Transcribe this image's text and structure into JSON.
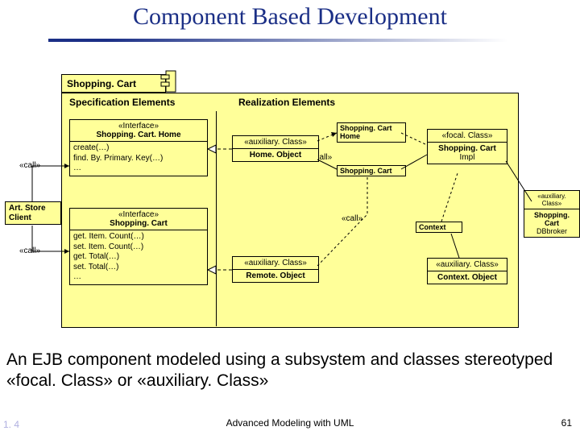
{
  "title": "Component Based Development",
  "tab": "Shopping. Cart",
  "sections": {
    "spec": "Specification Elements",
    "real": "Realization Elements"
  },
  "artstore": {
    "line1": "Art. Store",
    "line2": "Client"
  },
  "call": "«call»",
  "iface1": {
    "stereo": "«Interface»",
    "name": "Shopping. Cart. Home",
    "op1": "create(…)",
    "op2": "find. By. Primary. Key(…)",
    "op3": "…"
  },
  "iface2": {
    "stereo": "«Interface»",
    "name": "Shopping. Cart",
    "op1": "get. Item. Count(…)",
    "op2": "set. Item. Count(…)",
    "op3": "get. Total(…)",
    "op4": "set. Total(…)",
    "op5": "…"
  },
  "aux": "«auxiliary. Class»",
  "focal": "«focal. Class»",
  "homeObject": "Home. Object",
  "remoteObject": "Remote. Object",
  "scHome": {
    "l1": "Shopping. Cart",
    "l2": "Home"
  },
  "scName": "Shopping. Cart",
  "scImpl": {
    "l1": "Shopping. Cart",
    "l2": "Impl"
  },
  "context": "Context",
  "contextObject": "Context. Object",
  "scDbBroker": {
    "l1": "Shopping. Cart",
    "l2": "DBbroker"
  },
  "caption": "An EJB component modeled using a subsystem and classes stereotyped «focal. Class» or «auxiliary. Class»",
  "footer": {
    "left": "1. 4",
    "center": "Advanced Modeling with UML",
    "right": "61"
  }
}
